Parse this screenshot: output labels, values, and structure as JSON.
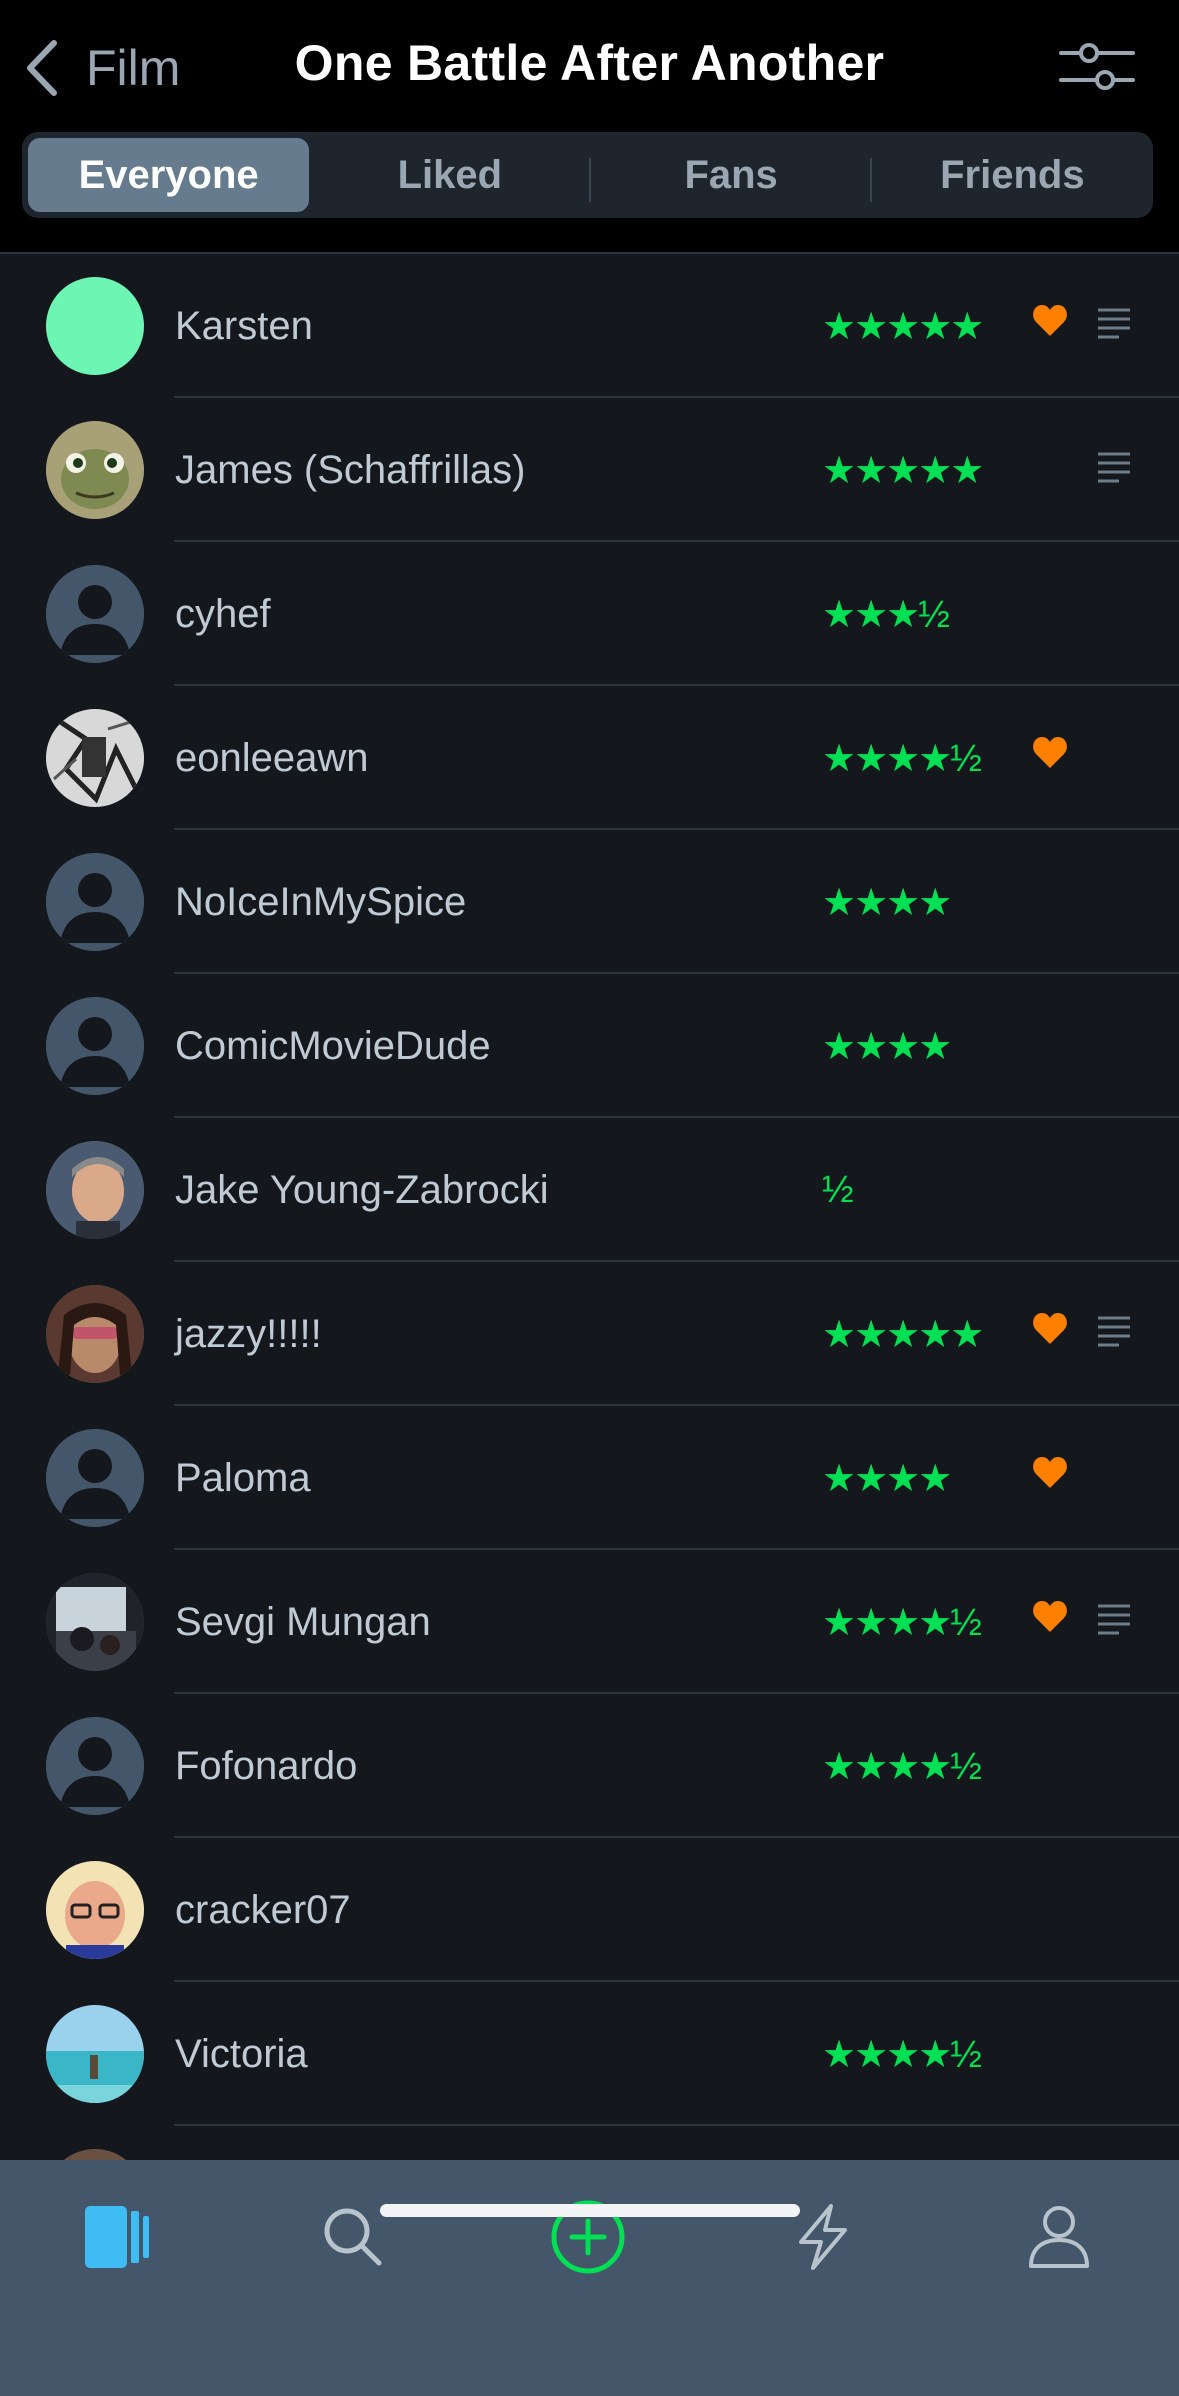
{
  "header": {
    "back_label": "Film",
    "title": "One Battle After Another"
  },
  "tabs": [
    {
      "label": "Everyone",
      "active": true
    },
    {
      "label": "Liked",
      "active": false
    },
    {
      "label": "Fans",
      "active": false
    },
    {
      "label": "Friends",
      "active": false
    }
  ],
  "rows": [
    {
      "name": "Karsten",
      "rating": "★★★★★",
      "liked": true,
      "review": true,
      "avatar": "mint"
    },
    {
      "name": "James (Schaffrillas)",
      "rating": "★★★★★",
      "liked": false,
      "review": true,
      "avatar": "turtle"
    },
    {
      "name": "cyhef",
      "rating": "★★★½",
      "liked": false,
      "review": false,
      "avatar": "default"
    },
    {
      "name": "eonleeawn",
      "rating": "★★★★½",
      "liked": true,
      "review": false,
      "avatar": "manga"
    },
    {
      "name": "NoIceInMySpice",
      "rating": "★★★★",
      "liked": false,
      "review": false,
      "avatar": "default"
    },
    {
      "name": "ComicMovieDude",
      "rating": "★★★★",
      "liked": false,
      "review": false,
      "avatar": "default"
    },
    {
      "name": "Jake Young-Zabrocki",
      "rating": "½",
      "liked": false,
      "review": false,
      "avatar": "man"
    },
    {
      "name": "jazzy!!!!!",
      "rating": "★★★★★",
      "liked": true,
      "review": true,
      "avatar": "woman"
    },
    {
      "name": "Paloma",
      "rating": "★★★★",
      "liked": true,
      "review": false,
      "avatar": "default"
    },
    {
      "name": "Sevgi Mungan",
      "rating": "★★★★½",
      "liked": true,
      "review": true,
      "avatar": "room"
    },
    {
      "name": "Fofonardo",
      "rating": "★★★★½",
      "liked": false,
      "review": false,
      "avatar": "default"
    },
    {
      "name": "cracker07",
      "rating": "",
      "liked": false,
      "review": false,
      "avatar": "glasses"
    },
    {
      "name": "Victoria",
      "rating": "★★★★½",
      "liked": false,
      "review": false,
      "avatar": "beach"
    },
    {
      "name": "",
      "rating": "",
      "liked": false,
      "review": false,
      "avatar": "partial"
    }
  ],
  "tabbar": [
    "films-icon",
    "search-icon",
    "add-icon",
    "activity-icon",
    "profile-icon"
  ],
  "colors": {
    "star": "#00e054",
    "heart": "#ff8000",
    "accent_blue": "#40bcf4",
    "background": "#14181c",
    "tabbar": "#44566a"
  }
}
